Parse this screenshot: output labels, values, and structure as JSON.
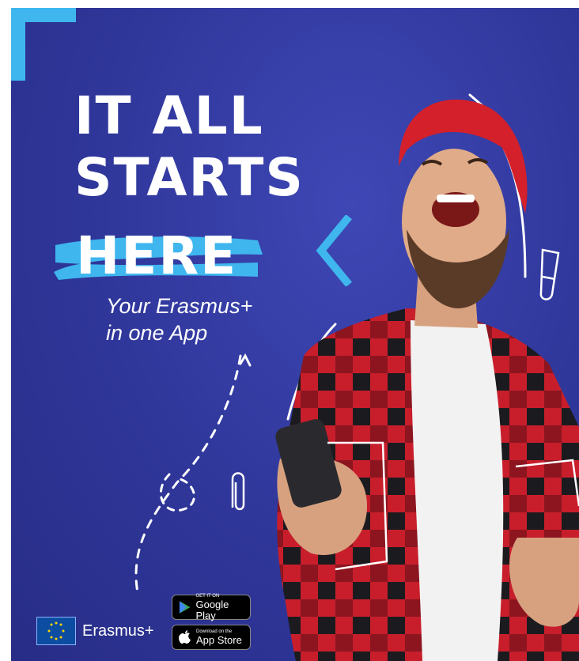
{
  "headline": {
    "line1": "IT ALL",
    "line2": "STARTS",
    "line3": "HERE"
  },
  "tagline": {
    "line1": "Your Erasmus+",
    "line2": "in one App"
  },
  "brand": {
    "name": "Erasmus+"
  },
  "stores": {
    "google_small": "GET IT ON",
    "google_big": "Google Play",
    "apple_small": "Download on the",
    "apple_big": "App Store"
  },
  "colors": {
    "background": "#2f3699",
    "accent": "#3fb6ee",
    "text": "#ffffff",
    "shirt_red": "#c81e2b",
    "beanie_red": "#d4202b"
  },
  "icons": [
    "corner-bracket-icon",
    "chevron-left-icon",
    "test-tube-icon",
    "paperclip-icon",
    "eu-flag-icon",
    "play-icon",
    "apple-icon"
  ]
}
